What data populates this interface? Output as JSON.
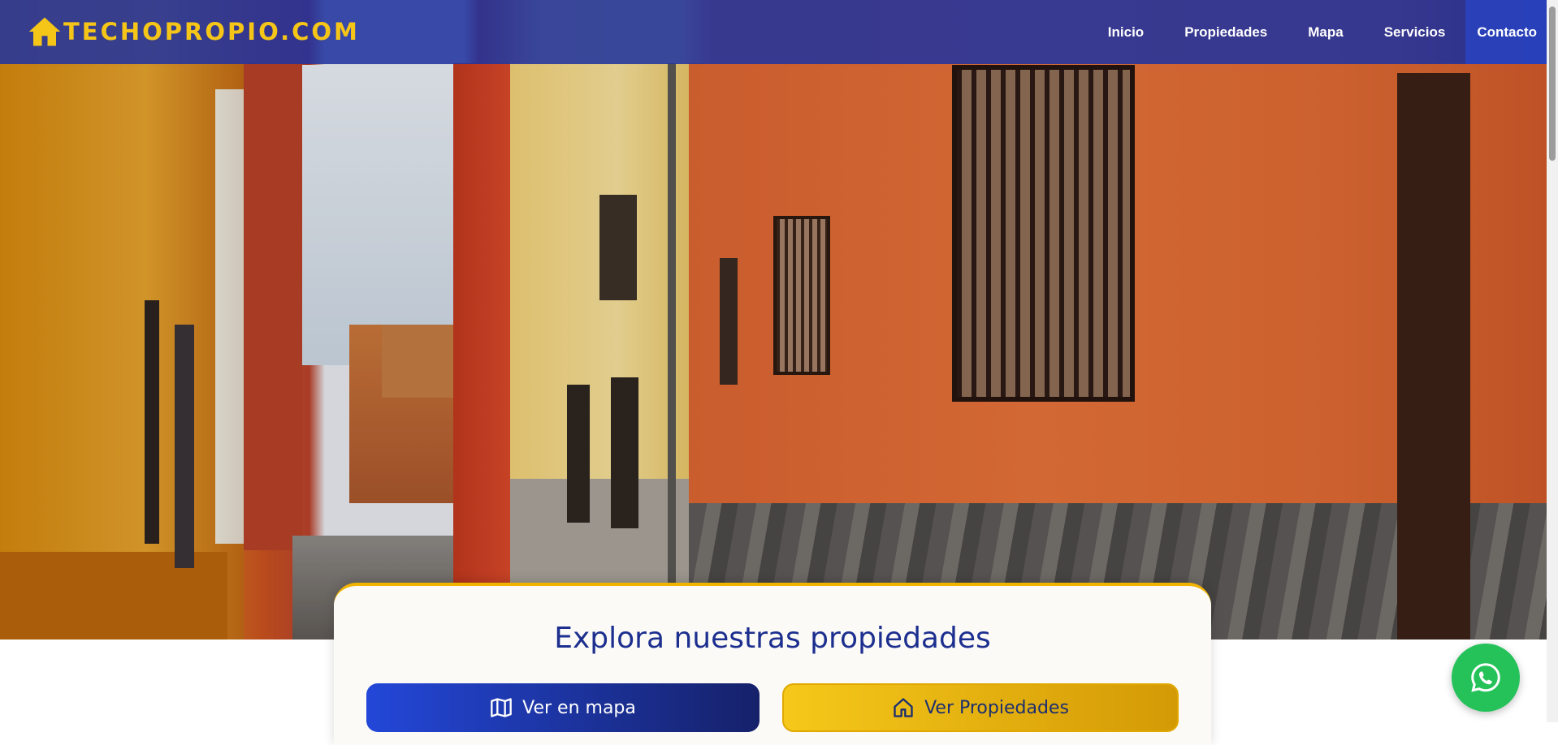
{
  "hero": {
    "image": "colorful-street-houses-photo"
  },
  "header": {
    "logo_text": "TECHOPROPIO.COM",
    "logo_icon": "house-icon",
    "nav": {
      "items": [
        "Inicio",
        "Propiedades",
        "Mapa",
        "Servicios",
        "Contacto"
      ]
    }
  },
  "explore": {
    "title": "Explora nuestras propiedades",
    "map_button": "Ver en mapa",
    "map_icon": "map-icon",
    "properties_button": "Ver Propiedades",
    "properties_icon": "home-outline-icon"
  },
  "whatsapp": {
    "icon": "whatsapp-icon"
  },
  "colors": {
    "navbar": "#1e32a0",
    "accent_yellow": "#f5c518",
    "title_blue": "#1c2f8f",
    "whatsapp_green": "#25c25a"
  }
}
